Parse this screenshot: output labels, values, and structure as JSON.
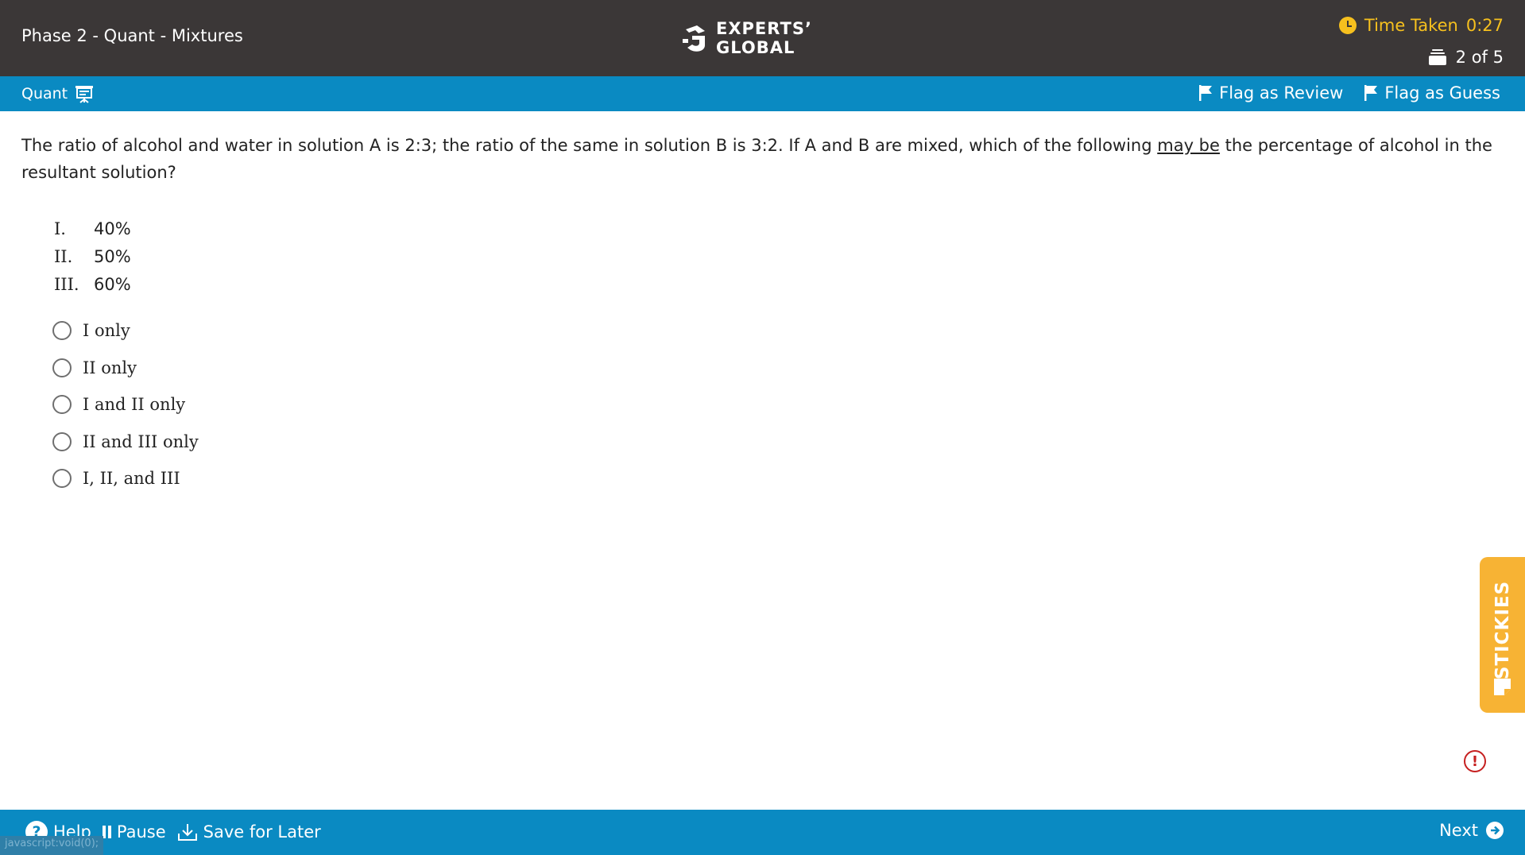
{
  "header": {
    "title": "Phase 2 - Quant - Mixtures",
    "logo_line1": "EXPERTS’",
    "logo_line2": "GLOBAL",
    "time_label": "Time Taken",
    "time_value": "0:27",
    "progress_text": "2 of 5"
  },
  "section_bar": {
    "section_name": "Quant",
    "flag_review_label": "Flag as Review",
    "flag_guess_label": "Flag as Guess"
  },
  "question": {
    "text_before": "The ratio of alcohol and water in solution A is 2:3; the ratio of the same in solution B is 3:2. If A and B are mixed, which of the following ",
    "text_underlined": "may be",
    "text_after": " the percentage of alcohol in the resultant solution?",
    "statements": [
      {
        "roman": "I.",
        "value": "40%"
      },
      {
        "roman": "II.",
        "value": "50%"
      },
      {
        "roman": "III.",
        "value": "60%"
      }
    ],
    "options": [
      "I only",
      "II only",
      "I and II only",
      "II and III only",
      "I, II, and III"
    ]
  },
  "stickies": {
    "label": "STICKIES"
  },
  "footer": {
    "help_label": "Help",
    "pause_label": "Pause",
    "save_label": "Save for Later",
    "next_label": "Next",
    "status_text": "javascript:void(0);"
  },
  "colors": {
    "header_bg": "#3b3737",
    "accent_blue": "#0a8ac2",
    "timer_yellow": "#f6c01e",
    "stickies_orange": "#f7b334",
    "alert_red": "#c62020"
  },
  "icons": [
    "clock-icon",
    "question-stack-icon",
    "whiteboard-icon",
    "flag-icon",
    "sticky-note-icon",
    "alert-icon",
    "help-icon",
    "pause-icon",
    "download-icon",
    "arrow-right-icon"
  ]
}
